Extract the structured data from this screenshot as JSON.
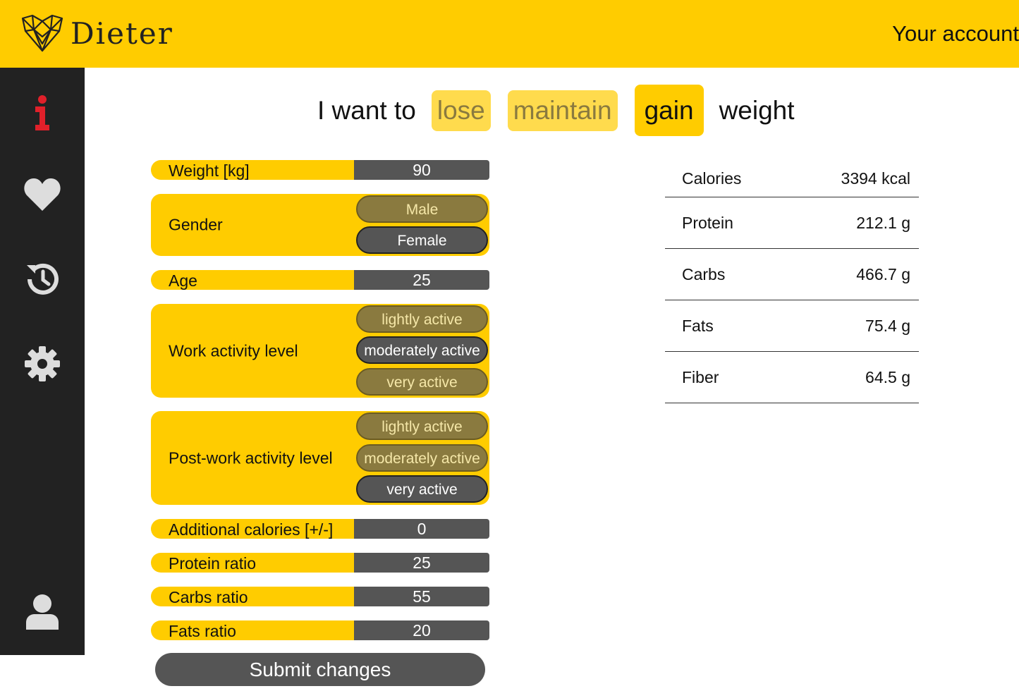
{
  "header": {
    "brand": "Dieter",
    "account_link": "Your account"
  },
  "sidebar": {
    "items": [
      {
        "icon": "info-icon",
        "color": "#e0202a"
      },
      {
        "icon": "heart-icon",
        "color": "#dddddd"
      },
      {
        "icon": "history-icon",
        "color": "#dddddd"
      },
      {
        "icon": "gear-icon",
        "color": "#dddddd"
      },
      {
        "icon": "user-icon",
        "color": "#dddddd"
      }
    ]
  },
  "goal": {
    "prefix": "I want to",
    "options": [
      "lose",
      "maintain",
      "gain"
    ],
    "selected": "gain",
    "suffix": "weight"
  },
  "form": {
    "weight": {
      "label": "Weight [kg]",
      "value": "90"
    },
    "gender": {
      "label": "Gender",
      "options": [
        "Male",
        "Female"
      ],
      "selected": "Female"
    },
    "age": {
      "label": "Age",
      "value": "25"
    },
    "work_activity": {
      "label": "Work activity level",
      "options": [
        "lightly active",
        "moderately active",
        "very active"
      ],
      "selected": "moderately active"
    },
    "post_work_activity": {
      "label": "Post-work activity level",
      "options": [
        "lightly active",
        "moderately active",
        "very active"
      ],
      "selected": "very active"
    },
    "additional_calories": {
      "label": "Additional calories [+/-]",
      "value": "0"
    },
    "protein_ratio": {
      "label": "Protein ratio",
      "value": "25"
    },
    "carbs_ratio": {
      "label": "Carbs ratio",
      "value": "55"
    },
    "fats_ratio": {
      "label": "Fats ratio",
      "value": "20"
    },
    "submit_label": "Submit changes"
  },
  "results": [
    {
      "name": "Calories",
      "value": "3394 kcal"
    },
    {
      "name": "Protein",
      "value": "212.1 g"
    },
    {
      "name": "Carbs",
      "value": "466.7 g"
    },
    {
      "name": "Fats",
      "value": "75.4 g"
    },
    {
      "name": "Fiber",
      "value": "64.5 g"
    }
  ],
  "colors": {
    "accent": "#ffcc00",
    "sidebar": "#222222",
    "input_bg": "#555555"
  }
}
